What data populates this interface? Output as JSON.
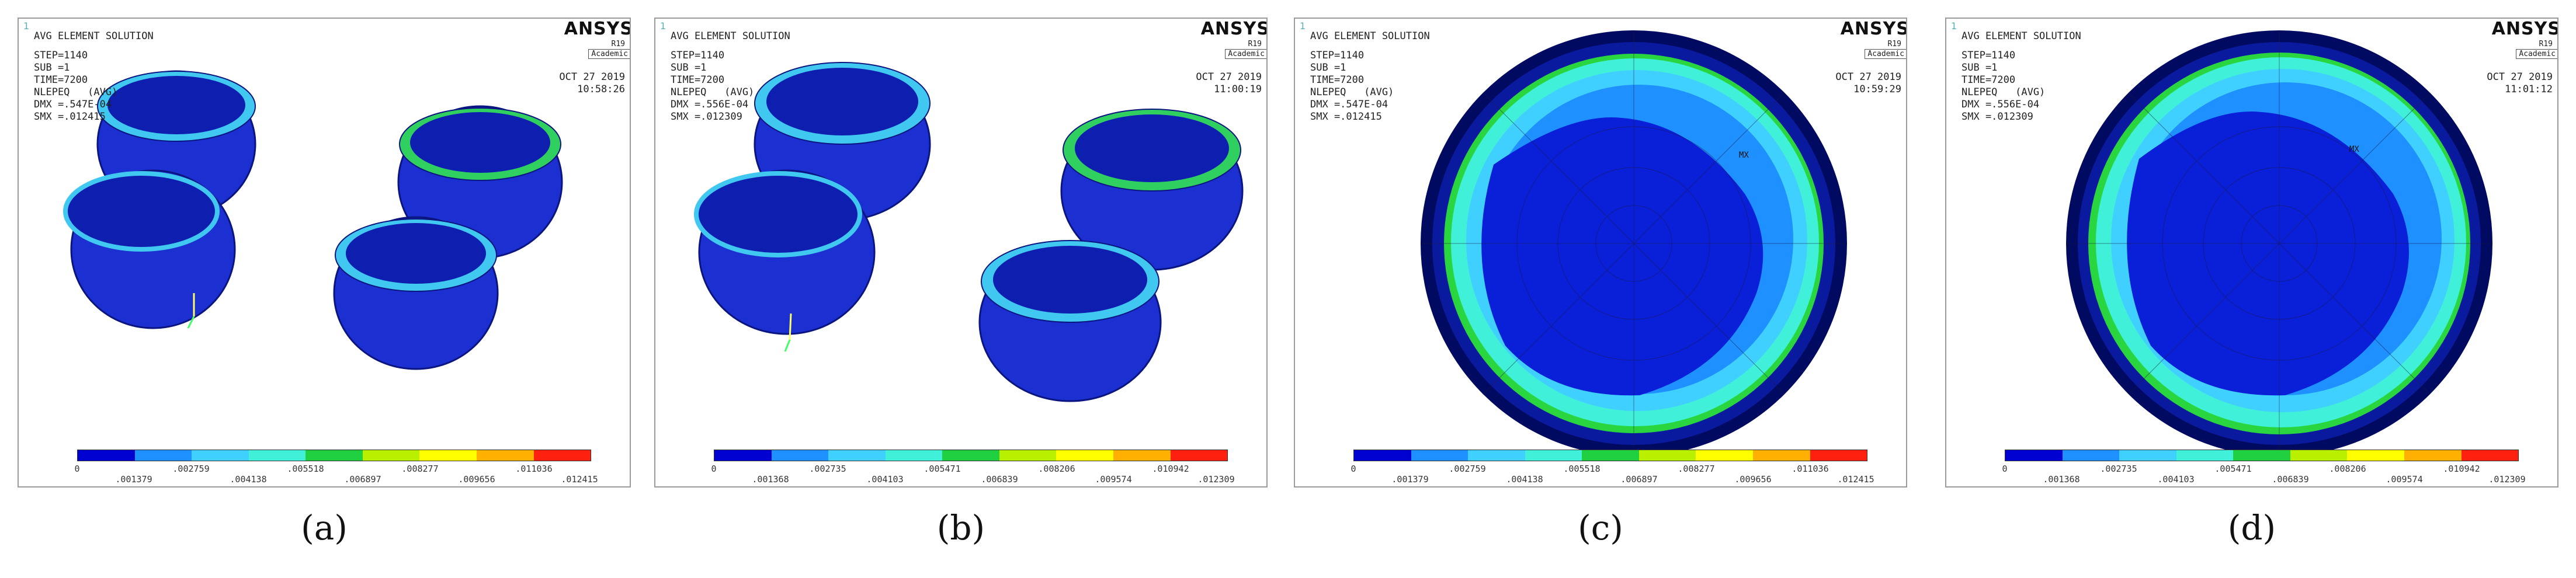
{
  "legend_colors": [
    "#0000d0",
    "#1e90ff",
    "#40d0ff",
    "#40f0d8",
    "#20d040",
    "#b8f000",
    "#ffff00",
    "#ffb000",
    "#ff2010"
  ],
  "panels": [
    {
      "corner": "1",
      "title": "AVG ELEMENT SOLUTION",
      "step": "STEP=1140",
      "sub": "SUB =1",
      "time": "TIME=7200",
      "quantity": "NLEPEQ   (AVG)",
      "dmx": "DMX =.547E-04",
      "smx": "SMX =.012415",
      "brand": "ANSYS",
      "release": "R19",
      "academic": "Academic",
      "date": "OCT 27 2019",
      "clock": "10:58:26",
      "ticks_top": [
        "0",
        ".002759",
        ".005518",
        ".008277",
        ".011036"
      ],
      "ticks_bottom": [
        ".001379",
        ".004138",
        ".006897",
        ".009656",
        ".012415"
      ],
      "caption": "(a)"
    },
    {
      "corner": "1",
      "title": "AVG ELEMENT SOLUTION",
      "step": "STEP=1140",
      "sub": "SUB =1",
      "time": "TIME=7200",
      "quantity": "NLEPEQ   (AVG)",
      "dmx": "DMX =.556E-04",
      "smx": "SMX =.012309",
      "brand": "ANSYS",
      "release": "R19",
      "academic": "Academic",
      "date": "OCT 27 2019",
      "clock": "11:00:19",
      "ticks_top": [
        "0",
        ".002735",
        ".005471",
        ".008206",
        ".010942"
      ],
      "ticks_bottom": [
        ".001368",
        ".004103",
        ".006839",
        ".009574",
        ".012309"
      ],
      "caption": "(b)"
    },
    {
      "corner": "1",
      "title": "AVG ELEMENT SOLUTION",
      "step": "STEP=1140",
      "sub": "SUB =1",
      "time": "TIME=7200",
      "quantity": "NLEPEQ   (AVG)",
      "dmx": "DMX =.547E-04",
      "smx": "SMX =.012415",
      "brand": "ANSYS",
      "release": "R19",
      "academic": "Academic",
      "date": "OCT 27 2019",
      "clock": "10:59:29",
      "ticks_top": [
        "0",
        ".002759",
        ".005518",
        ".008277",
        ".011036"
      ],
      "ticks_bottom": [
        ".001379",
        ".004138",
        ".006897",
        ".009656",
        ".012415"
      ],
      "node_label": "MX",
      "caption": "(c)"
    },
    {
      "corner": "1",
      "title": "AVG ELEMENT SOLUTION",
      "step": "STEP=1140",
      "sub": "SUB =1",
      "time": "TIME=7200",
      "quantity": "NLEPEQ   (AVG)",
      "dmx": "DMX =.556E-04",
      "smx": "SMX =.012309",
      "brand": "ANSYS",
      "release": "R19",
      "academic": "Academic",
      "date": "OCT 27 2019",
      "clock": "11:01:12",
      "ticks_top": [
        "0",
        ".002735",
        ".005471",
        ".008206",
        ".010942"
      ],
      "ticks_bottom": [
        ".001368",
        ".004103",
        ".006839",
        ".009574",
        ".012309"
      ],
      "node_label": "MX",
      "caption": "(d)"
    }
  ]
}
